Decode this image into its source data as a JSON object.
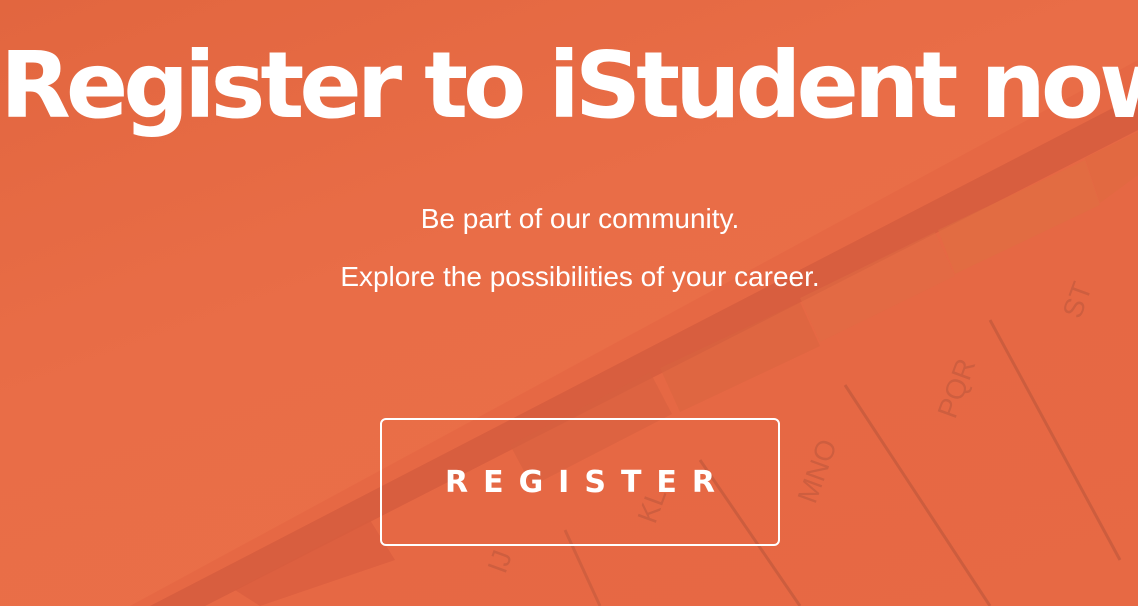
{
  "hero": {
    "headline": "Register to iStudent now!",
    "subtitle_line1": "Be part of our community.",
    "subtitle_line2": "Explore the possibilities of your career.",
    "register_label": "REGISTER"
  },
  "background_tabs": [
    "IJ",
    "KL",
    "MNO",
    "PQR",
    "ST"
  ],
  "colors": {
    "brand_orange": "#e86c46",
    "text": "#ffffff"
  }
}
